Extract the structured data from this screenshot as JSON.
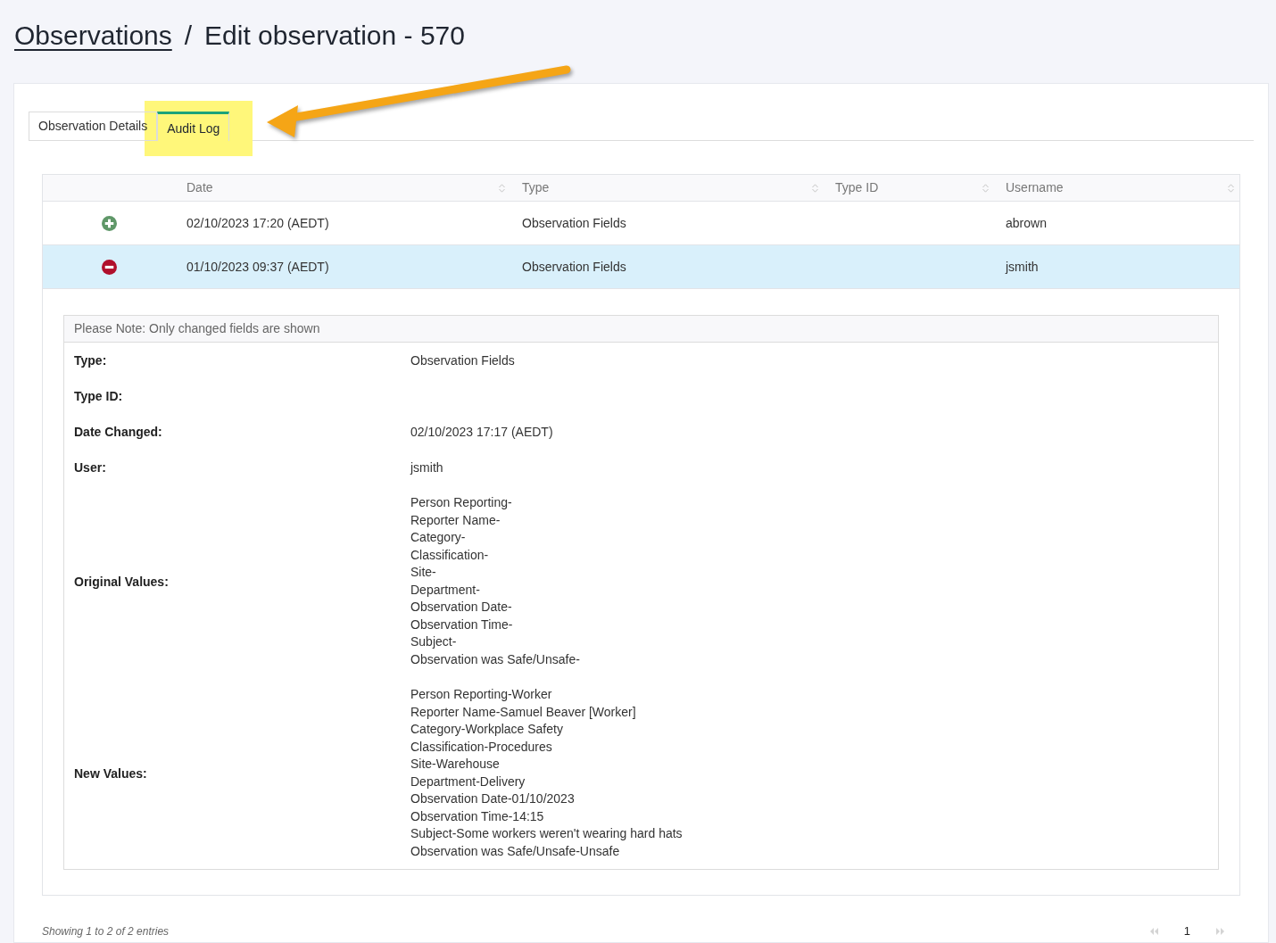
{
  "breadcrumb": {
    "parent": "Observations",
    "separator": "/",
    "current": "Edit observation - 570"
  },
  "tabs": [
    {
      "label": "Observation Details",
      "selected": false,
      "highlighted": false
    },
    {
      "label": "Audit Log",
      "selected": true,
      "highlighted": true
    }
  ],
  "table": {
    "columns": [
      "Date",
      "Type",
      "Type ID",
      "Username"
    ],
    "rows": [
      {
        "expanded": false,
        "selected": false,
        "date": "02/10/2023 17:20 (AEDT)",
        "type": "Observation Fields",
        "username": "abrown"
      },
      {
        "expanded": true,
        "selected": true,
        "date": "01/10/2023 09:37 (AEDT)",
        "type": "Observation Fields",
        "username": "jsmith",
        "details": {
          "note": "Please Note: Only changed fields are shown",
          "fields": [
            {
              "label": "Type:",
              "value": "Observation Fields"
            },
            {
              "label": "Type ID:"
            },
            {
              "label": "Date Changed:",
              "value": "02/10/2023 17:17 (AEDT)"
            },
            {
              "label": "User:",
              "value": "jsmith"
            },
            {
              "label": "Original Values:",
              "lines": [
                "Person Reporting-",
                "Reporter Name-",
                "Category-",
                "Classification-",
                "Site-",
                "Department-",
                "Observation Date-",
                "Observation Time-",
                "Subject-",
                "Observation was Safe/Unsafe-"
              ]
            },
            {
              "label": "New Values:",
              "lines": [
                "Person Reporting-Worker",
                "Reporter Name-Samuel Beaver [Worker]",
                "Category-Workplace Safety",
                "Classification-Procedures",
                "Site-Warehouse",
                "Department-Delivery",
                "Observation Date-01/10/2023",
                "Observation Time-14:15",
                "Subject-Some workers weren't wearing hard hats",
                "Observation was Safe/Unsafe-Unsafe"
              ]
            }
          ]
        }
      }
    ]
  },
  "footer": {
    "info": "Showing 1 to 2 of 2 entries",
    "pagination": {
      "previous": {
        "disabled": true
      },
      "pages": [
        {
          "label": "1",
          "selected": true
        }
      ],
      "next": {
        "disabled": true
      }
    }
  }
}
